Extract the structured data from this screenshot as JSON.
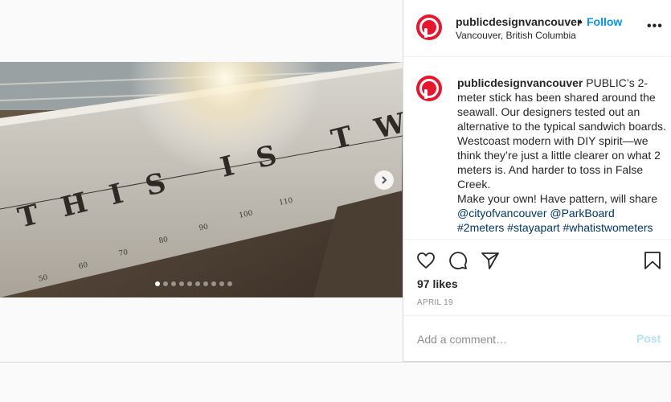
{
  "post": {
    "username": "publicdesignvancouver",
    "separator": "•",
    "follow_label": "Follow",
    "location": "Vancouver, British Columbia",
    "more_label": "•••",
    "photo": {
      "headline": "THIS IS TWO METERS",
      "ruler_labels": [
        "50",
        "60",
        "70",
        "80",
        "90",
        "100",
        "110"
      ],
      "slide_count": 10,
      "active_slide": 1
    }
  },
  "caption": {
    "username": "publicdesignvancouver",
    "text": "PUBLIC’s 2-meter stick has been shared around the seawall. Our designers tested out an alternative to the typical sandwich boards. Westcoast modern with DIY spirit—we think they’re just a little clearer on what 2 meters is. And harder to toss in False Creek.",
    "line2": "Make your own! Have pattern, will share",
    "mentions": [
      "@cityofvancouver",
      "@ParkBoard"
    ],
    "hashtags": [
      "#2meters",
      "#stayapart",
      "#whatistwometers"
    ]
  },
  "stats": {
    "likes": "97 likes",
    "date": "APRIL 19"
  },
  "comment": {
    "placeholder": "Add a comment…",
    "post_label": "Post"
  },
  "colors": {
    "brand_red": "#e8162d",
    "follow_blue": "#0095f6",
    "link_navy": "#00376b",
    "post_disabled": "#b2dffc"
  },
  "icons": [
    "next-arrow-icon",
    "heart-icon",
    "comment-icon",
    "share-icon",
    "bookmark-icon",
    "more-icon"
  ]
}
